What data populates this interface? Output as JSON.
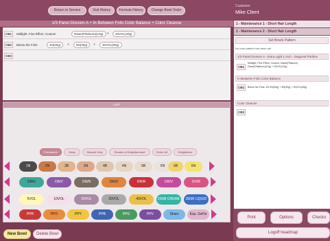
{
  "toolbar": {
    "return_to_service": "Return to Service",
    "visit_history": "Visit History",
    "formula_history": "Formula History",
    "change_bowl_order": "Change Bowl Order"
  },
  "formula": {
    "title": "1/3 Panel Division A + In-Between Foils Color Balance + Color Cleanse",
    "rows": [
      {
        "bowl": "CB1",
        "label": "Midlight, Fine Effect, Custom",
        "items": [
          "Dawn(Platinum)(10g)",
          "20VOL(20g)"
        ],
        "ops": [
          "+"
        ]
      },
      {
        "bowl": "CB2",
        "label": "Below the Foils",
        "items": [
          "4N(30g)",
          "5N(30g)",
          "30VOL(60g)"
        ],
        "ops": [
          "+",
          "+"
        ]
      },
      {
        "bowl": "CB3",
        "label": "",
        "items": [],
        "ops": []
      }
    ]
  },
  "list": {
    "title": "LIST",
    "categories": [
      "Permanent",
      "Deep",
      "Deposit Only",
      "Shades of Enlightenment",
      "Extra Lift",
      "Enlightener"
    ],
    "rows": [
      [
        "1N",
        "2N",
        "3B",
        "3N",
        "4B",
        "4N",
        "5B",
        "5N",
        "6B",
        "6N"
      ],
      [
        "DB/G",
        "DB/V",
        "DN/N",
        "DR/O",
        "DR/R",
        "DR/V",
        "DV/R"
      ],
      [
        "5VOL",
        "10VOL",
        "20VOL",
        "30VOL",
        "40VOL",
        "DEMI CREME",
        "DEMI LIQUID"
      ],
      [
        "PPR",
        "PPO",
        "PPY",
        "PPB",
        "PPG",
        "PPV",
        "Sham",
        "Equ. SoFin"
      ]
    ]
  },
  "bottom": {
    "new_bowl": "New Bowl",
    "delete_bowl": "Delete Bowl"
  },
  "customer": {
    "label": "Customer",
    "name": "Mike Client",
    "services": [
      "1 - Maintenance 1 - Short Hair Length",
      "2 - Maintenance 2 - Short Hair Length"
    ],
    "set_bowls": "Set Bowls Pattern",
    "no_pattern": "No bowl pattern has been set",
    "sections": [
      {
        "title": "1/3 Panel Division A - Extra Light 1 Inch - Diagonal Partline",
        "bowl": "CB1",
        "text1": "Midlight, Fine Effect, Custom: Dawn(Platinum)",
        "text2": "Dawn(Platinum)(10g) + 20VOL(20g)"
      },
      {
        "title": "In-Between Foils Color Balance",
        "bowl": "CB2",
        "text1": "Below the Foils: 4/5 4N(30g) + 5N(30g) + 30VOL(60g)",
        "text2": ""
      },
      {
        "title": "Color Cleanse",
        "bowl": "CB3",
        "text1": "",
        "text2": ""
      }
    ],
    "buttons": {
      "print": "Print",
      "options": "Options",
      "checkout": "Checko",
      "logoff": "Logoff headmap"
    }
  },
  "colors": {
    "accent": "#7a3a52",
    "arrow": "#cf3c8c"
  }
}
